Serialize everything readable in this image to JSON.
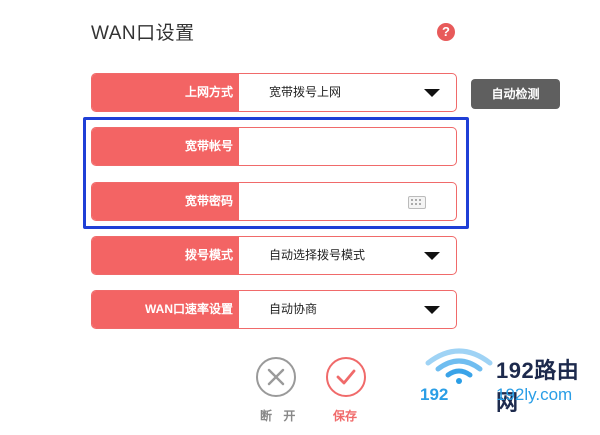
{
  "header": {
    "title": "WAN口设置",
    "help_glyph": "?"
  },
  "fields": [
    {
      "label": "上网方式",
      "value": "宽带拨号上网"
    },
    {
      "label": "宽带帐号",
      "value": ""
    },
    {
      "label": "宽带密码",
      "value": ""
    },
    {
      "label": "拨号模式",
      "value": "自动选择拨号模式"
    },
    {
      "label": "WAN口速率设置",
      "value": "自动协商"
    }
  ],
  "auto_detect_label": "自动检测",
  "actions": {
    "disconnect_label": "断 开",
    "save_label": "保存"
  },
  "watermark": {
    "brand": "192路由网",
    "prefix": "192",
    "domain": "192ly.com"
  },
  "colors": {
    "accent": "#f36464",
    "highlight": "#1f3fd6",
    "detect_bg": "#5f5f5f",
    "watermark_blue": "#2a9ee6"
  }
}
